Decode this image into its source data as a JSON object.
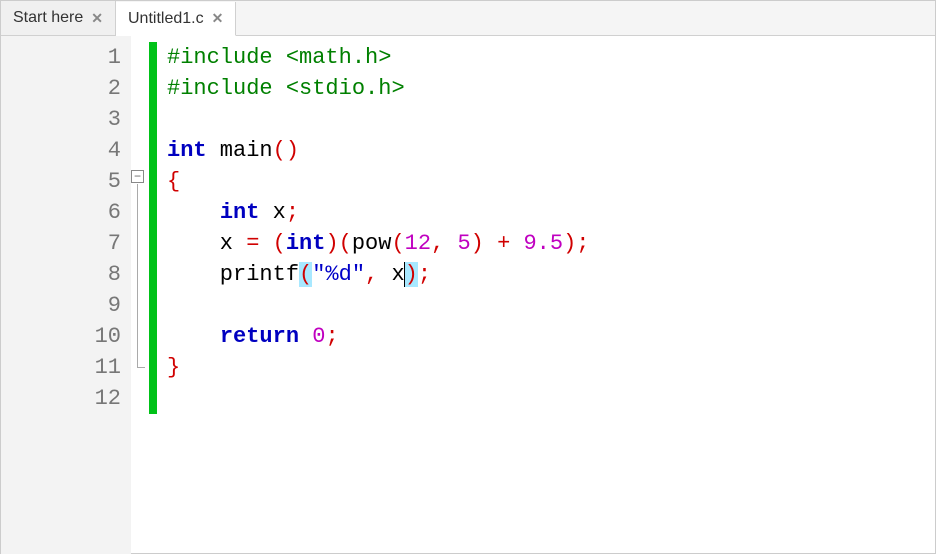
{
  "tabs": [
    {
      "label": "Start here",
      "close": "✕",
      "active": false
    },
    {
      "label": "Untitled1.c",
      "close": "✕",
      "active": true
    }
  ],
  "editor": {
    "line_numbers": [
      "1",
      "2",
      "3",
      "4",
      "5",
      "6",
      "7",
      "8",
      "9",
      "10",
      "11",
      "12"
    ],
    "fold_minus": "−",
    "code": {
      "l1_include": "#include ",
      "l1_hdr": "<math.h>",
      "l2_include": "#include ",
      "l2_hdr": "<stdio.h>",
      "l4_int": "int",
      "l4_main": " main",
      "l4_paren": "()",
      "l5_brace": "{",
      "l6_int": "int",
      "l6_rest": " x",
      "l6_semi": ";",
      "l7_pre": "    x ",
      "l7_eq": "=",
      "l7_sp1": " ",
      "l7_op1": "(",
      "l7_int": "int",
      "l7_op2": ")(",
      "l7_pow": "pow",
      "l7_op3": "(",
      "l7_n1": "12",
      "l7_op4": ",",
      "l7_sp2": " ",
      "l7_n2": "5",
      "l7_op5": ")",
      "l7_sp3": " ",
      "l7_op6": "+",
      "l7_sp4": " ",
      "l7_n3": "9.5",
      "l7_op7": ");",
      "l8_printf": "    printf",
      "l8_op1": "(",
      "l8_str": "\"%d\"",
      "l8_op2": ",",
      "l8_sp": " x",
      "l8_op3": ")",
      "l8_op4": ";",
      "l10_return": "return",
      "l10_sp": " ",
      "l10_n": "0",
      "l10_semi": ";",
      "l11_brace": "}"
    }
  }
}
